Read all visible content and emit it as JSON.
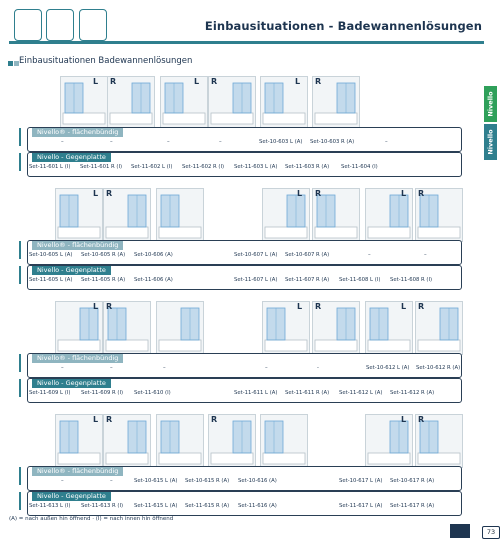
{
  "header": {
    "title": "Einbausituationen - Badewannenlösungen"
  },
  "section": {
    "title": "Einbausituationen Badewannenlösungen"
  },
  "side_tabs": {
    "tab1": "Nivello",
    "tab2": "Nivello"
  },
  "labels": {
    "flush": "Nivello® - flächenbündig",
    "counter": "Nivello - Gegenplatte"
  },
  "rows": [
    {
      "images": [
        "L",
        "R",
        "L",
        "R",
        "L",
        "R"
      ],
      "flush": [
        "–",
        "–",
        "–",
        "–",
        "Set-10-603 L (A)",
        "Set-10-603 R (A)",
        "–"
      ],
      "counter": [
        "Set-11-601 L (I)",
        "Set-11-601 R (I)",
        "Set-11-602 L (I)",
        "Set-11-602 R (I)",
        "Set-11-603 L (A)",
        "Set-11-603 R (A)",
        "Set-11-604 (I)"
      ]
    },
    {
      "images": [
        "L",
        "R",
        "",
        "L",
        "R",
        "L",
        "R"
      ],
      "flush": [
        "Set-10-605 L (A)",
        "Set-10-605 R (A)",
        "Set-10-606 (A)",
        "Set-10-607 L (A)",
        "Set-10-607 R (A)",
        "–",
        "–"
      ],
      "counter": [
        "Set-11-605 L (A)",
        "Set-11-605 R (A)",
        "Set-11-606 (A)",
        "Set-11-607 L (A)",
        "Set-11-607 R (A)",
        "Set-11-608 L (I)",
        "Set-11-608 R (I)"
      ]
    },
    {
      "images": [
        "L",
        "R",
        "",
        "L",
        "R",
        "L",
        "R"
      ],
      "flush": [
        "–",
        "–",
        "–",
        "–",
        "-",
        "Set-10-612 L (A)",
        "Set-10-612 R (A)"
      ],
      "counter": [
        "Set-11-609 L (I)",
        "Set-11-609 R (I)",
        "Set-11-610 (I)",
        "Set-11-611 L (A)",
        "Set-11-611 R (A)",
        "Set-11-612 L (A)",
        "Set-11-612 R (A)"
      ]
    },
    {
      "images": [
        "L",
        "R",
        "R",
        "",
        "L",
        "R"
      ],
      "flush": [
        "–",
        "–",
        "Set-10-615 L (A)",
        "Set-10-615 R (A)",
        "Set-10-616 (A)",
        "Set-10-617 L (A)",
        "Set-10-617 R (A)"
      ],
      "counter": [
        "Set-11-613 L (I)",
        "Set-11-613 R (I)",
        "Set-11-615 L (A)",
        "Set-11-615 R (A)",
        "Set-11-616 (A)",
        "Set-11-617 L (A)",
        "Set-11-617 R (A)"
      ]
    }
  ],
  "legend": "(A) = nach außen hin öffnend · (I) = nach innen hin öffnend",
  "page_number": "73",
  "colors": {
    "teal": "#2f7f8e",
    "green": "#2fa05a",
    "navy": "#1e3550",
    "glass": "#6ea9d6"
  }
}
